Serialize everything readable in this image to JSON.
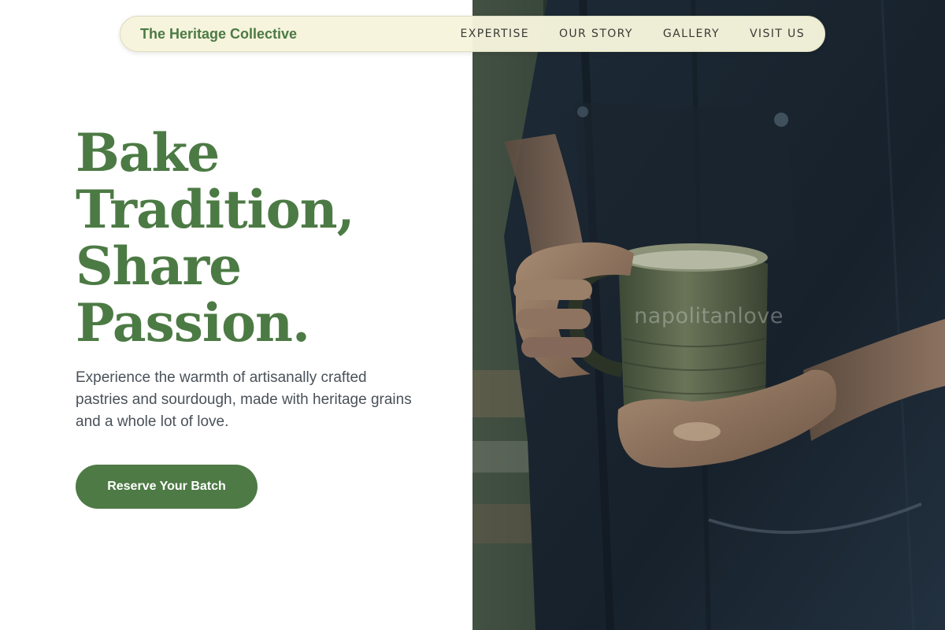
{
  "nav": {
    "brand": "The Heritage Collective",
    "links": [
      "EXPERTISE",
      "OUR STORY",
      "GALLERY",
      "VISIT US"
    ]
  },
  "hero": {
    "headline_lines": [
      "Bake",
      "Tradition,",
      "Share",
      "Passion."
    ],
    "lede": "Experience the warmth of artisanally crafted pastries and sourdough, made with heritage grains and a whole lot of love.",
    "cta_label": "Reserve Your Batch"
  },
  "photo": {
    "watermark": "napolitanlove"
  },
  "colors": {
    "brand_green": "#4c7a44",
    "cta_green": "#4e7a45",
    "nav_bg": "#f6f4dc",
    "body_text": "#4a5159"
  }
}
